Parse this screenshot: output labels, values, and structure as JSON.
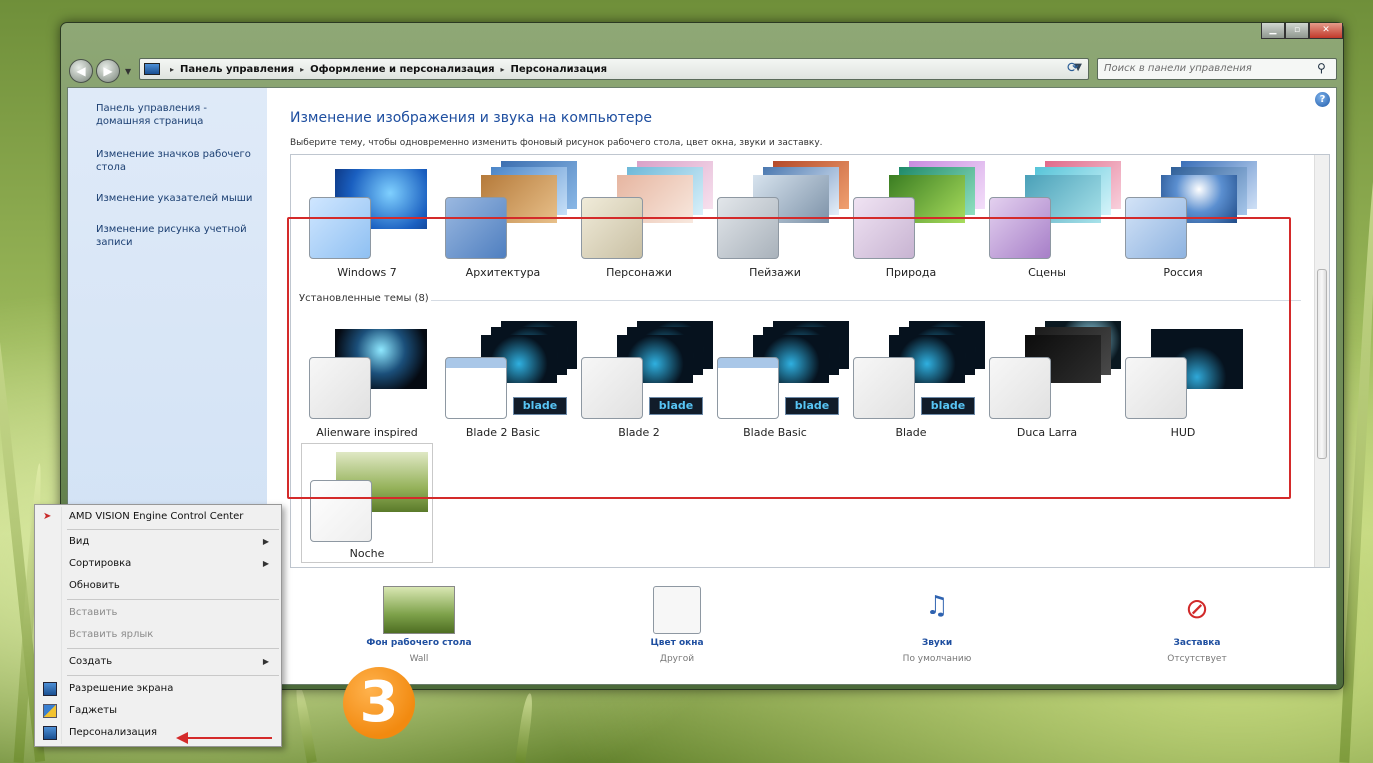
{
  "window": {
    "breadcrumb": [
      "Панель управления",
      "Оформление и персонализация",
      "Персонализация"
    ],
    "search_placeholder": "Поиск в панели управления"
  },
  "sidebar": {
    "items": [
      "Панель управления - домашняя страница",
      "Изменение значков рабочего стола",
      "Изменение указателей мыши",
      "Изменение рисунка учетной записи"
    ]
  },
  "main": {
    "title": "Изменение изображения и звука на компьютере",
    "subtitle": "Выберите тему, чтобы одновременно изменить фоновый рисунок рабочего стола, цвет окна, звуки и заставку.",
    "aero_themes": [
      "Windows 7",
      "Архитектура",
      "Персонажи",
      "Пейзажи",
      "Природа",
      "Сцены",
      "Россия"
    ],
    "installed_label": "Установленные темы (8)",
    "installed_themes": [
      "Alienware inspired",
      "Blade 2 Basic",
      "Blade 2",
      "Blade Basic",
      "Blade",
      "Duca Larra",
      "HUD",
      "Noche"
    ],
    "badge_text": "blade"
  },
  "bottom": {
    "items": [
      {
        "title": "Фон рабочего стола",
        "sub": "Wall"
      },
      {
        "title": "Цвет окна",
        "sub": "Другой"
      },
      {
        "title": "Звуки",
        "sub": "По умолчанию"
      },
      {
        "title": "Заставка",
        "sub": "Отсутствует"
      }
    ]
  },
  "context_menu": {
    "items": [
      "AMD VISION Engine Control Center",
      "Вид",
      "Сортировка",
      "Обновить",
      "Вставить",
      "Вставить ярлык",
      "Создать",
      "Разрешение экрана",
      "Гаджеты",
      "Персонализация"
    ]
  },
  "marker_number": "3",
  "colors": {
    "link": "#1f4fa0",
    "highlight_frame": "#d42a2a",
    "marker": "#f28a10"
  }
}
